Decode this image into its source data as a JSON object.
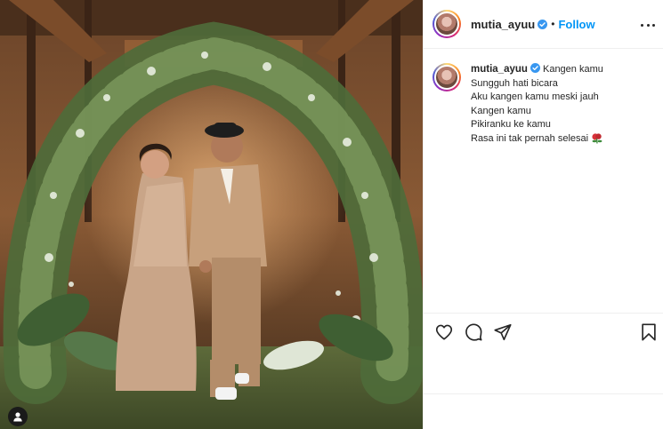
{
  "post": {
    "username": "mutia_ayuu",
    "separator": "•",
    "follow_label": "Follow",
    "photo_alt": "Couple walking through a floral arch",
    "caption_lines": [
      "Kangen kamu",
      "Sungguh hati bicara",
      "Aku kangen kamu meski jauh",
      "Kangen kamu",
      "Pikiranku ke kamu",
      "Rasa ini tak pernah selesai"
    ]
  },
  "icons": {
    "verified": "verified-badge-icon",
    "more": "more-options-icon",
    "like": "heart-icon",
    "comment": "comment-icon",
    "share": "share-icon",
    "save": "bookmark-icon",
    "tag": "user-tag-icon",
    "emoji": "rose-emoji-icon"
  },
  "colors": {
    "follow": "#0095f6",
    "verified": "#3897f0",
    "text": "#262626",
    "border": "#efefef"
  }
}
